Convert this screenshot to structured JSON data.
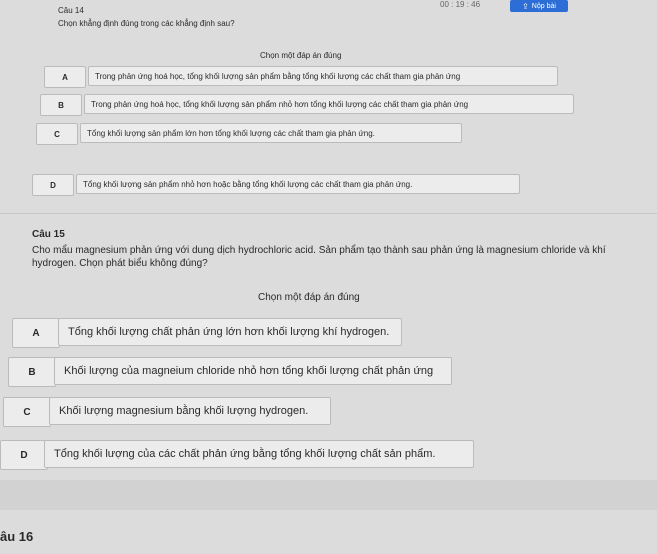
{
  "topbar": {
    "timer": "00 : 19 : 46",
    "submit_label": "Nộp bài"
  },
  "q14": {
    "number": "Câu 14",
    "text": "Chọn khẳng định đúng trong các khẳng định sau?",
    "instruction": "Chọn một đáp án đúng",
    "options": [
      {
        "letter": "A",
        "text": "Trong phản ứng hoá học, tổng khối lượng sản phẩm bằng tổng khối lượng các chất tham gia phản ứng"
      },
      {
        "letter": "B",
        "text": "Trong phản ứng hoá học, tổng khối lượng sản phẩm nhỏ hơn tổng khối lượng các chất tham gia phản ứng"
      },
      {
        "letter": "C",
        "text": "Tổng khối lượng sản phẩm lớn hơn tổng khối lượng các chất tham gia phản ứng."
      },
      {
        "letter": "D",
        "text": "Tổng khối lượng sản phẩm nhỏ hơn hoặc bằng tổng khối lượng các chất tham gia phản ứng."
      }
    ]
  },
  "q15": {
    "number": "Câu 15",
    "text": "Cho mẩu magnesium phản ứng với dung dịch hydrochloric acid. Sản phẩm tạo thành sau phản ứng là magnesium chloride và khí hydrogen. Chọn phát biểu không đúng?",
    "instruction": "Chọn một đáp án đúng",
    "options": [
      {
        "letter": "A",
        "text": "Tổng khối lượng chất phản ứng lớn hơn khối lượng khí hydrogen."
      },
      {
        "letter": "B",
        "text": "Khối lượng của magneium chloride nhỏ hơn tổng khối lượng chất phản ứng"
      },
      {
        "letter": "C",
        "text": "Khối lượng magnesium bằng khối lượng hydrogen."
      },
      {
        "letter": "D",
        "text": "Tổng khối lượng của các chất phản ứng bằng tổng khối lượng chất sản phẩm."
      }
    ]
  },
  "q16": {
    "number": "âu 16"
  }
}
